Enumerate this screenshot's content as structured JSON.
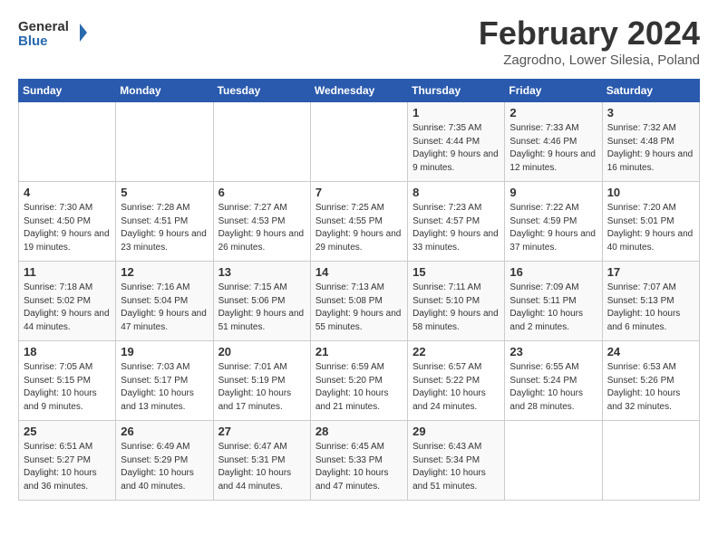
{
  "header": {
    "logo_general": "General",
    "logo_blue": "Blue",
    "title": "February 2024",
    "subtitle": "Zagrodno, Lower Silesia, Poland"
  },
  "weekdays": [
    "Sunday",
    "Monday",
    "Tuesday",
    "Wednesday",
    "Thursday",
    "Friday",
    "Saturday"
  ],
  "weeks": [
    [
      {
        "day": "",
        "sunrise": "",
        "sunset": "",
        "daylight": ""
      },
      {
        "day": "",
        "sunrise": "",
        "sunset": "",
        "daylight": ""
      },
      {
        "day": "",
        "sunrise": "",
        "sunset": "",
        "daylight": ""
      },
      {
        "day": "",
        "sunrise": "",
        "sunset": "",
        "daylight": ""
      },
      {
        "day": "1",
        "sunrise": "Sunrise: 7:35 AM",
        "sunset": "Sunset: 4:44 PM",
        "daylight": "Daylight: 9 hours and 9 minutes."
      },
      {
        "day": "2",
        "sunrise": "Sunrise: 7:33 AM",
        "sunset": "Sunset: 4:46 PM",
        "daylight": "Daylight: 9 hours and 12 minutes."
      },
      {
        "day": "3",
        "sunrise": "Sunrise: 7:32 AM",
        "sunset": "Sunset: 4:48 PM",
        "daylight": "Daylight: 9 hours and 16 minutes."
      }
    ],
    [
      {
        "day": "4",
        "sunrise": "Sunrise: 7:30 AM",
        "sunset": "Sunset: 4:50 PM",
        "daylight": "Daylight: 9 hours and 19 minutes."
      },
      {
        "day": "5",
        "sunrise": "Sunrise: 7:28 AM",
        "sunset": "Sunset: 4:51 PM",
        "daylight": "Daylight: 9 hours and 23 minutes."
      },
      {
        "day": "6",
        "sunrise": "Sunrise: 7:27 AM",
        "sunset": "Sunset: 4:53 PM",
        "daylight": "Daylight: 9 hours and 26 minutes."
      },
      {
        "day": "7",
        "sunrise": "Sunrise: 7:25 AM",
        "sunset": "Sunset: 4:55 PM",
        "daylight": "Daylight: 9 hours and 29 minutes."
      },
      {
        "day": "8",
        "sunrise": "Sunrise: 7:23 AM",
        "sunset": "Sunset: 4:57 PM",
        "daylight": "Daylight: 9 hours and 33 minutes."
      },
      {
        "day": "9",
        "sunrise": "Sunrise: 7:22 AM",
        "sunset": "Sunset: 4:59 PM",
        "daylight": "Daylight: 9 hours and 37 minutes."
      },
      {
        "day": "10",
        "sunrise": "Sunrise: 7:20 AM",
        "sunset": "Sunset: 5:01 PM",
        "daylight": "Daylight: 9 hours and 40 minutes."
      }
    ],
    [
      {
        "day": "11",
        "sunrise": "Sunrise: 7:18 AM",
        "sunset": "Sunset: 5:02 PM",
        "daylight": "Daylight: 9 hours and 44 minutes."
      },
      {
        "day": "12",
        "sunrise": "Sunrise: 7:16 AM",
        "sunset": "Sunset: 5:04 PM",
        "daylight": "Daylight: 9 hours and 47 minutes."
      },
      {
        "day": "13",
        "sunrise": "Sunrise: 7:15 AM",
        "sunset": "Sunset: 5:06 PM",
        "daylight": "Daylight: 9 hours and 51 minutes."
      },
      {
        "day": "14",
        "sunrise": "Sunrise: 7:13 AM",
        "sunset": "Sunset: 5:08 PM",
        "daylight": "Daylight: 9 hours and 55 minutes."
      },
      {
        "day": "15",
        "sunrise": "Sunrise: 7:11 AM",
        "sunset": "Sunset: 5:10 PM",
        "daylight": "Daylight: 9 hours and 58 minutes."
      },
      {
        "day": "16",
        "sunrise": "Sunrise: 7:09 AM",
        "sunset": "Sunset: 5:11 PM",
        "daylight": "Daylight: 10 hours and 2 minutes."
      },
      {
        "day": "17",
        "sunrise": "Sunrise: 7:07 AM",
        "sunset": "Sunset: 5:13 PM",
        "daylight": "Daylight: 10 hours and 6 minutes."
      }
    ],
    [
      {
        "day": "18",
        "sunrise": "Sunrise: 7:05 AM",
        "sunset": "Sunset: 5:15 PM",
        "daylight": "Daylight: 10 hours and 9 minutes."
      },
      {
        "day": "19",
        "sunrise": "Sunrise: 7:03 AM",
        "sunset": "Sunset: 5:17 PM",
        "daylight": "Daylight: 10 hours and 13 minutes."
      },
      {
        "day": "20",
        "sunrise": "Sunrise: 7:01 AM",
        "sunset": "Sunset: 5:19 PM",
        "daylight": "Daylight: 10 hours and 17 minutes."
      },
      {
        "day": "21",
        "sunrise": "Sunrise: 6:59 AM",
        "sunset": "Sunset: 5:20 PM",
        "daylight": "Daylight: 10 hours and 21 minutes."
      },
      {
        "day": "22",
        "sunrise": "Sunrise: 6:57 AM",
        "sunset": "Sunset: 5:22 PM",
        "daylight": "Daylight: 10 hours and 24 minutes."
      },
      {
        "day": "23",
        "sunrise": "Sunrise: 6:55 AM",
        "sunset": "Sunset: 5:24 PM",
        "daylight": "Daylight: 10 hours and 28 minutes."
      },
      {
        "day": "24",
        "sunrise": "Sunrise: 6:53 AM",
        "sunset": "Sunset: 5:26 PM",
        "daylight": "Daylight: 10 hours and 32 minutes."
      }
    ],
    [
      {
        "day": "25",
        "sunrise": "Sunrise: 6:51 AM",
        "sunset": "Sunset: 5:27 PM",
        "daylight": "Daylight: 10 hours and 36 minutes."
      },
      {
        "day": "26",
        "sunrise": "Sunrise: 6:49 AM",
        "sunset": "Sunset: 5:29 PM",
        "daylight": "Daylight: 10 hours and 40 minutes."
      },
      {
        "day": "27",
        "sunrise": "Sunrise: 6:47 AM",
        "sunset": "Sunset: 5:31 PM",
        "daylight": "Daylight: 10 hours and 44 minutes."
      },
      {
        "day": "28",
        "sunrise": "Sunrise: 6:45 AM",
        "sunset": "Sunset: 5:33 PM",
        "daylight": "Daylight: 10 hours and 47 minutes."
      },
      {
        "day": "29",
        "sunrise": "Sunrise: 6:43 AM",
        "sunset": "Sunset: 5:34 PM",
        "daylight": "Daylight: 10 hours and 51 minutes."
      },
      {
        "day": "",
        "sunrise": "",
        "sunset": "",
        "daylight": ""
      },
      {
        "day": "",
        "sunrise": "",
        "sunset": "",
        "daylight": ""
      }
    ]
  ]
}
